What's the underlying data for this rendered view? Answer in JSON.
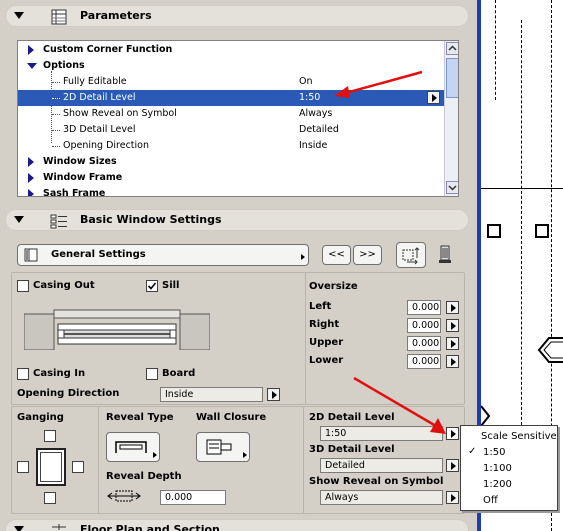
{
  "parameters_section": {
    "title": "Parameters"
  },
  "param_tree": {
    "rows": [
      {
        "label": "Custom Corner Function",
        "value": ""
      },
      {
        "label": "Options",
        "value": ""
      },
      {
        "label": "Fully Editable",
        "value": "On"
      },
      {
        "label": "2D Detail Level",
        "value": "1:50"
      },
      {
        "label": "Show Reveal on Symbol",
        "value": "Always"
      },
      {
        "label": "3D Detail Level",
        "value": "Detailed"
      },
      {
        "label": "Opening Direction",
        "value": "Inside"
      },
      {
        "label": "Window Sizes",
        "value": ""
      },
      {
        "label": "Window Frame",
        "value": ""
      },
      {
        "label": "Sash Frame",
        "value": ""
      }
    ]
  },
  "basic_section": {
    "title": "Basic Window Settings"
  },
  "settings_bar": {
    "dropdown_label": "General Settings",
    "prev_label": "<<",
    "next_label": ">>"
  },
  "casing": {
    "casing_out": "Casing Out",
    "sill": "Sill",
    "casing_in": "Casing In",
    "board": "Board",
    "opening_direction_label": "Opening Direction",
    "opening_direction_value": "Inside"
  },
  "oversize": {
    "title": "Oversize",
    "left_label": "Left",
    "left_value": "0.000",
    "right_label": "Right",
    "right_value": "0.000",
    "upper_label": "Upper",
    "upper_value": "0.000",
    "lower_label": "Lower",
    "lower_value": "0.000"
  },
  "ganging": {
    "title": "Ganging"
  },
  "reveal": {
    "type_label": "Reveal Type",
    "wall_closure_label": "Wall Closure",
    "depth_label": "Reveal Depth",
    "depth_value": "0.000"
  },
  "detail": {
    "level_2d_label": "2D Detail Level",
    "level_2d_value": "1:50",
    "level_3d_label": "3D Detail Level",
    "level_3d_value": "Detailed",
    "reveal_symbol_label": "Show Reveal on Symbol",
    "reveal_symbol_value": "Always"
  },
  "detail_menu": {
    "items": [
      "Scale Sensitive",
      "1:50",
      "1:100",
      "1:200",
      "Off"
    ],
    "checked": "1:50"
  },
  "floor_section": {
    "title": "Floor Plan and Section"
  },
  "colors": {
    "selection": "#2a5ab6",
    "annotation_arrow": "#e01010",
    "canvas_border": "#1e3cb4"
  }
}
